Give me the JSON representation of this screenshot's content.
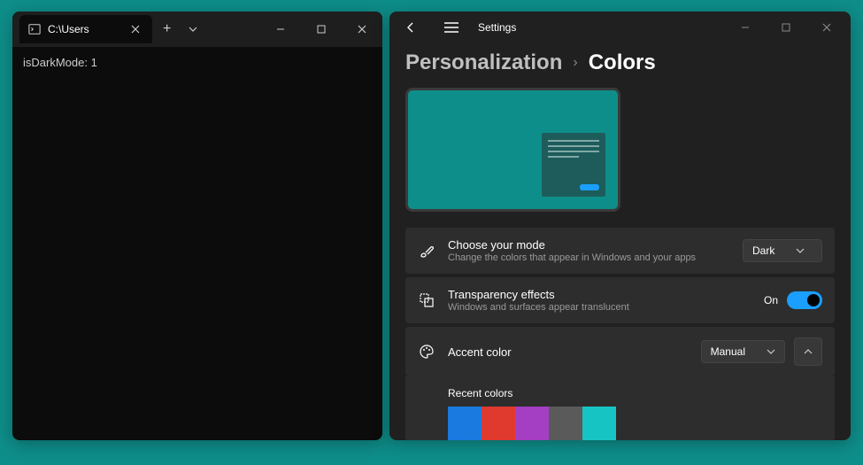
{
  "terminal": {
    "tab_title": "C:\\Users",
    "output": "isDarkMode: 1"
  },
  "settings": {
    "app_title": "Settings",
    "breadcrumb_parent": "Personalization",
    "breadcrumb_current": "Colors",
    "mode": {
      "label": "Choose your mode",
      "desc": "Change the colors that appear in Windows and your apps",
      "value": "Dark"
    },
    "transparency": {
      "label": "Transparency effects",
      "desc": "Windows and surfaces appear translucent",
      "state_label": "On"
    },
    "accent": {
      "label": "Accent color",
      "value": "Manual",
      "recent_label": "Recent colors",
      "recent_colors": [
        "#1a7ae0",
        "#e03a2f",
        "#a43fc4",
        "#5a5a5a",
        "#17c4c4"
      ]
    }
  }
}
